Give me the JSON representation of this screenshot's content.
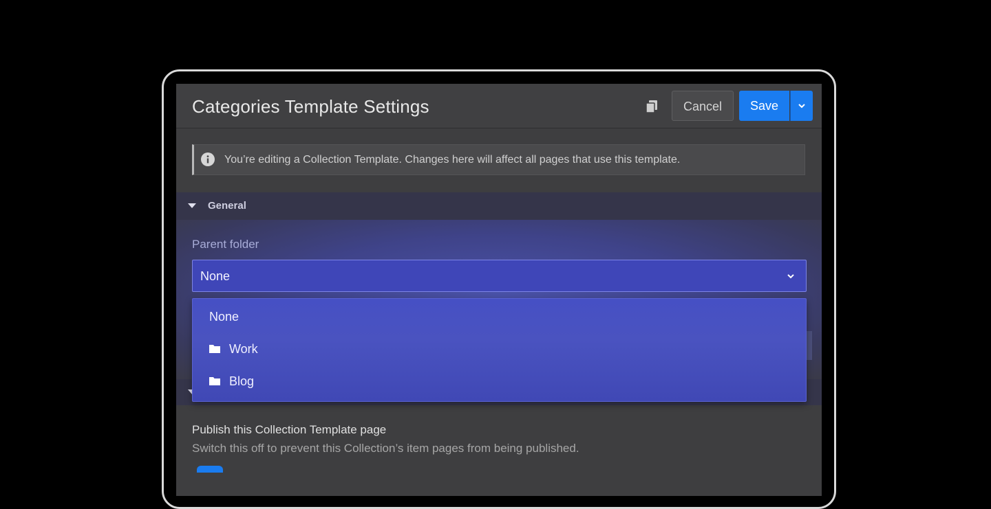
{
  "header": {
    "title": "Categories Template Settings",
    "cancel_label": "Cancel",
    "save_label": "Save"
  },
  "info_banner": {
    "text": "You’re editing a Collection Template. Changes here will affect all pages that use this template."
  },
  "general_section": {
    "title": "General",
    "parent_folder": {
      "label": "Parent folder",
      "selected": "None",
      "options": [
        {
          "label": "None",
          "icon": ""
        },
        {
          "label": "Work",
          "icon": "folder-icon"
        },
        {
          "label": "Blog",
          "icon": "folder-icon"
        }
      ]
    }
  },
  "publish_section": {
    "title": "Publish this Collection Template page",
    "description": "Switch this off to prevent this Collection’s item pages from being published."
  },
  "colors": {
    "accent": "#1a7cf0",
    "dropdown": "#4650c4",
    "panel": "#3e3e40"
  }
}
